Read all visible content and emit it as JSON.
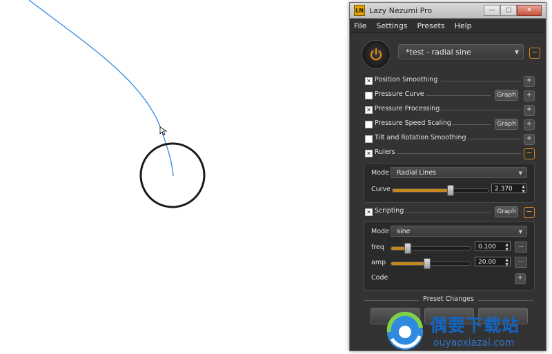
{
  "window": {
    "title": "Lazy Nezumi Pro",
    "app_icon_text": "LN",
    "buttons": {
      "minimize": "—",
      "maximize": "□",
      "close": "✕"
    }
  },
  "menu": [
    "File",
    "Settings",
    "Presets",
    "Help"
  ],
  "preset": {
    "name": "*test - radial sine",
    "dropdown_arrow": "▼",
    "collapse_button": "−"
  },
  "features": [
    {
      "label": "Position Smoothing",
      "checked": true,
      "graph": false,
      "button": "+"
    },
    {
      "label": "Pressure Curve",
      "checked": false,
      "graph": true,
      "button": "+"
    },
    {
      "label": "Pressure Processing",
      "checked": true,
      "graph": false,
      "button": "+"
    },
    {
      "label": "Pressure Speed Scaling",
      "checked": false,
      "graph": true,
      "button": "+"
    },
    {
      "label": "Tilt and Rotation Smoothing",
      "checked": false,
      "graph": false,
      "button": "+"
    },
    {
      "label": "Rulers",
      "checked": true,
      "graph": false,
      "button": "−"
    }
  ],
  "graph_label": "Graph",
  "rulers_panel": {
    "mode_label": "Mode",
    "mode_value": "Radial Lines",
    "curve_label": "Curve",
    "curve_slider": 0.6,
    "curve_value": "2.370"
  },
  "scripting": {
    "label": "Scripting",
    "checked": true,
    "graph_label": "Graph",
    "button": "−"
  },
  "scripting_panel": {
    "mode_label": "Mode",
    "mode_value": "sine",
    "freq_label": "freq",
    "freq_slider": 0.2,
    "freq_value": "0.100",
    "amp_label": "amp",
    "amp_slider": 0.45,
    "amp_value": "20.00",
    "code_label": "Code",
    "code_button": "+",
    "more_button": "..."
  },
  "preset_changes_label": "Preset Changes",
  "watermark": {
    "text": "偶要下载站",
    "url": "ouyaoxiazai.com"
  }
}
